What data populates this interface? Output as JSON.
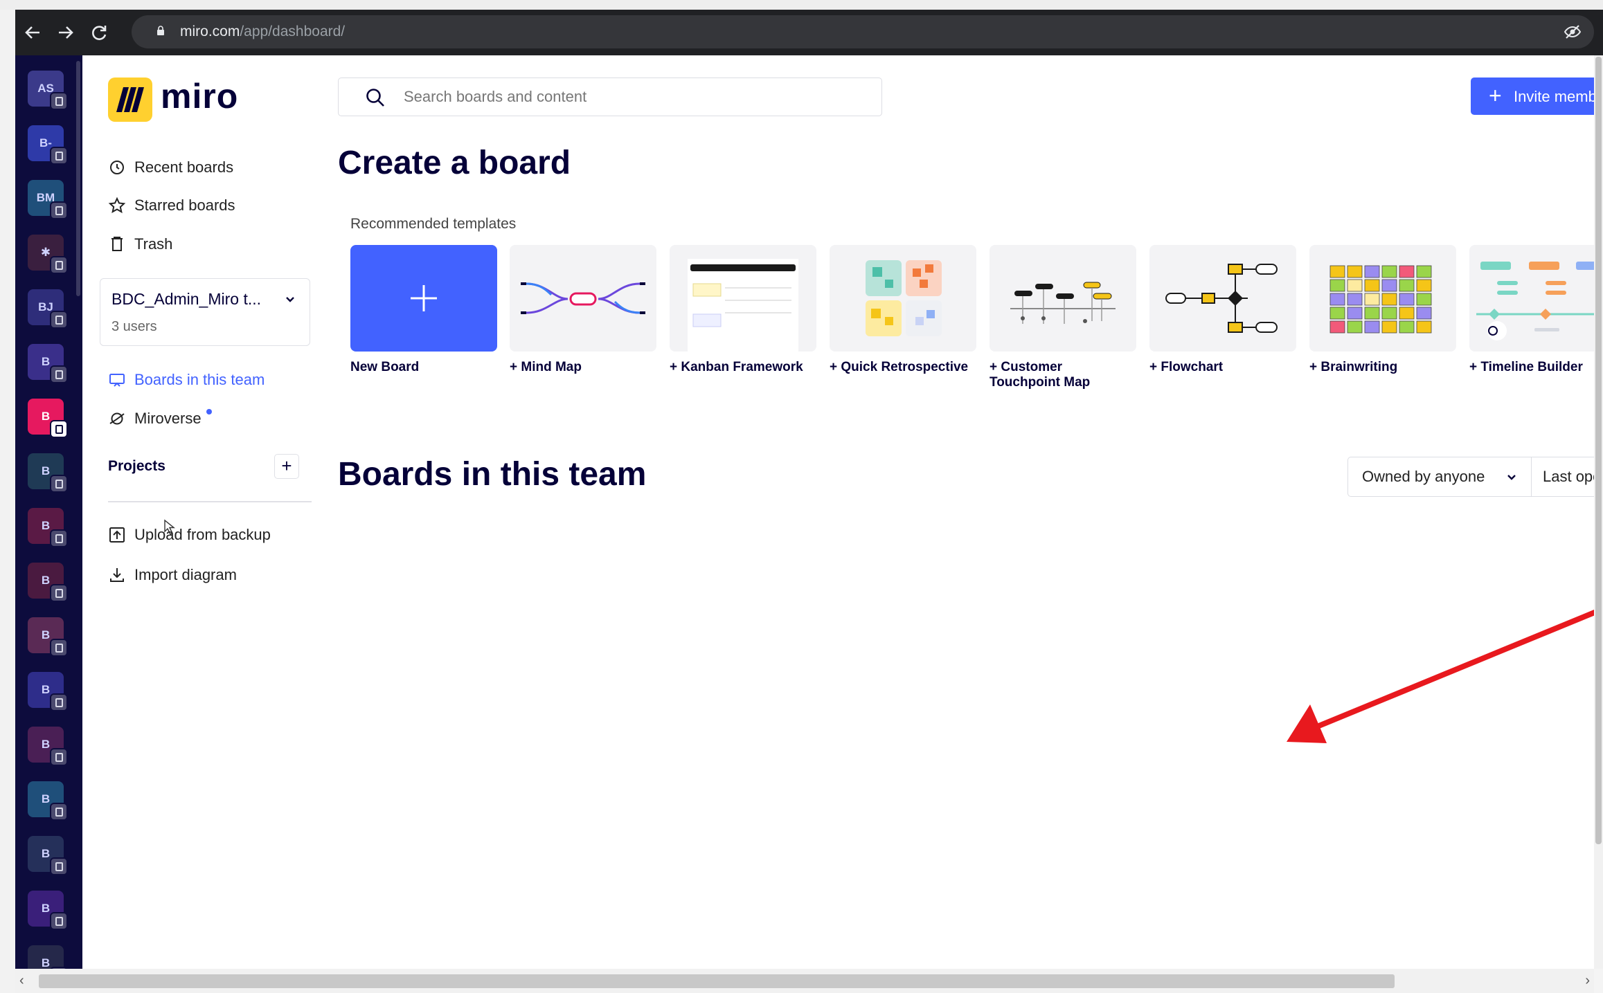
{
  "browser": {
    "url_host": "miro.com",
    "url_path": "/app/dashboard/"
  },
  "teams": [
    {
      "initials": "AS",
      "color": "#3b3a8a"
    },
    {
      "initials": "B-",
      "color": "#2e3aa8"
    },
    {
      "initials": "BM",
      "color": "#1f4f7a"
    },
    {
      "initials": "✱",
      "color": "#3a1f3f"
    },
    {
      "initials": "BJ",
      "color": "#2e2d7a"
    },
    {
      "initials": "B",
      "color": "#3a2f8a"
    },
    {
      "initials": "B",
      "color": "#e6195f",
      "active": true
    },
    {
      "initials": "B",
      "color": "#1f3a55"
    },
    {
      "initials": "B",
      "color": "#5a1a45"
    },
    {
      "initials": "B",
      "color": "#4a1a40"
    },
    {
      "initials": "B",
      "color": "#5a2a55"
    },
    {
      "initials": "B",
      "color": "#2e2d8a"
    },
    {
      "initials": "B",
      "color": "#4a1f55"
    },
    {
      "initials": "B",
      "color": "#1f4f7a"
    },
    {
      "initials": "B",
      "color": "#25305a"
    },
    {
      "initials": "B",
      "color": "#3a1f7a"
    },
    {
      "initials": "B",
      "color": "#25284a"
    }
  ],
  "sidebar": {
    "logo": "miro",
    "recent": "Recent boards",
    "starred": "Starred boards",
    "trash": "Trash",
    "team_name": "BDC_Admin_Miro t...",
    "team_users": "3 users",
    "boards_in_team": "Boards in this team",
    "miroverse": "Miroverse",
    "projects": "Projects",
    "projects_add": "+",
    "upload": "Upload from backup",
    "import": "Import diagram"
  },
  "header": {
    "search_placeholder": "Search boards and content",
    "invite": "Invite memb"
  },
  "main": {
    "create_title": "Create a board",
    "recommended": "Recommended templates",
    "templates": [
      {
        "label": "New Board"
      },
      {
        "label": "+ Mind Map"
      },
      {
        "label": "+ Kanban Framework"
      },
      {
        "label": "+ Quick Retrospective"
      },
      {
        "label": "+ Customer Touchpoint Map"
      },
      {
        "label": "+ Flowchart"
      },
      {
        "label": "+ Brainwriting"
      },
      {
        "label": "+ Timeline Builder"
      }
    ],
    "boards_title": "Boards in this team",
    "owned_filter": "Owned by anyone",
    "sort": "Last ope"
  },
  "colors": {
    "accent": "#4262ff",
    "brand_yellow": "#ffd02f",
    "annotation_arrow": "#e8191e"
  }
}
